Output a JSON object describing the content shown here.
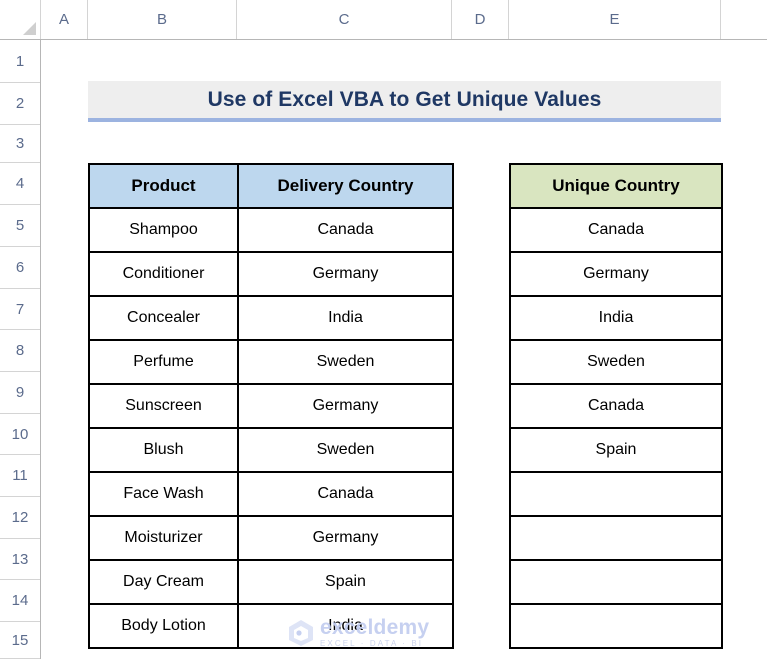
{
  "app": {
    "type": "spreadsheet",
    "columns": [
      "A",
      "B",
      "C",
      "D",
      "E"
    ],
    "rows": [
      "1",
      "2",
      "3",
      "4",
      "5",
      "6",
      "7",
      "8",
      "9",
      "10",
      "11",
      "12",
      "13",
      "14",
      "15"
    ]
  },
  "banner": {
    "title": "Use of Excel VBA to Get Unique Values",
    "background_color": "#EEEEEE",
    "text_color": "#1F3864",
    "underline_color": "#9CB3E0"
  },
  "main_table": {
    "headers": [
      "Product",
      "Delivery Country"
    ],
    "header_fill": "#BDD7EE",
    "rows": [
      {
        "product": "Shampoo",
        "country": "Canada"
      },
      {
        "product": "Conditioner",
        "country": "Germany"
      },
      {
        "product": "Concealer",
        "country": "India"
      },
      {
        "product": "Perfume",
        "country": "Sweden"
      },
      {
        "product": "Sunscreen",
        "country": "Germany"
      },
      {
        "product": "Blush",
        "country": "Sweden"
      },
      {
        "product": "Face Wash",
        "country": "Canada"
      },
      {
        "product": "Moisturizer",
        "country": "Germany"
      },
      {
        "product": "Day Cream",
        "country": "Spain"
      },
      {
        "product": "Body Lotion",
        "country": "India"
      }
    ]
  },
  "unique_table": {
    "header": "Unique Country",
    "header_fill": "#D9E5C0",
    "values": [
      "Canada",
      "Germany",
      "India",
      "Sweden",
      "Canada",
      "Spain",
      "",
      "",
      "",
      ""
    ]
  },
  "watermark": {
    "name": "exceldemy",
    "tagline": "EXCEL · DATA · BI",
    "color": "#C3CEF0"
  }
}
